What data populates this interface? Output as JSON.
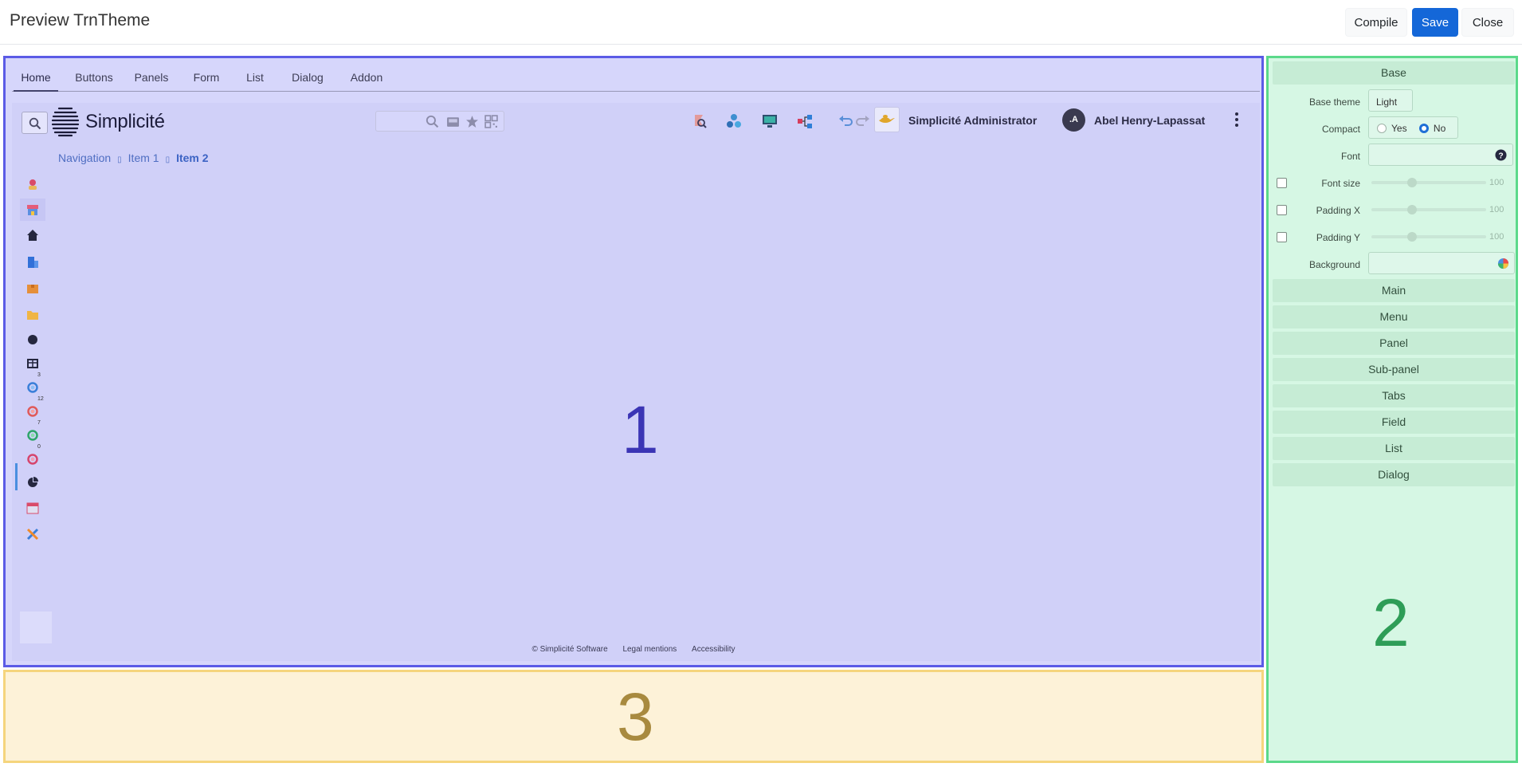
{
  "header": {
    "title": "Preview TrnTheme",
    "buttons": {
      "compile": "Compile",
      "save": "Save",
      "close": "Close"
    }
  },
  "zone1": {
    "label": "1",
    "tabs": [
      "Home",
      "Buttons",
      "Panels",
      "Form",
      "List",
      "Dialog",
      "Addon"
    ],
    "active_tab": "Home",
    "app": {
      "brand": "Simplicité",
      "admin_name": "Simplicité Administrator",
      "user_name": "Abel Henry-Lapassat",
      "avatar_initials": ".A",
      "breadcrumb": [
        "Navigation",
        "Item 1",
        "Item 2"
      ],
      "breadcrumb_separator": "▯",
      "sidebar": [
        {
          "icon": "user-icon"
        },
        {
          "icon": "store-icon",
          "selected": true
        },
        {
          "icon": "home-icon"
        },
        {
          "icon": "building-icon"
        },
        {
          "icon": "box-icon"
        },
        {
          "icon": "folder-icon"
        },
        {
          "icon": "circle-icon"
        },
        {
          "icon": "table-icon"
        },
        {
          "icon": "badge-blue-icon",
          "badge": "3"
        },
        {
          "icon": "badge-red-icon",
          "badge": "12"
        },
        {
          "icon": "badge-green-icon",
          "badge": "7"
        },
        {
          "icon": "badge-pink-icon",
          "badge": "0"
        },
        {
          "icon": "pie-chart-icon"
        },
        {
          "icon": "calendar-icon"
        },
        {
          "icon": "tools-icon"
        }
      ],
      "footer": [
        "© Simplicité Software",
        "Legal mentions",
        "Accessibility"
      ]
    }
  },
  "zone2": {
    "label": "2",
    "base_section": "Base",
    "fields": {
      "base_theme_label": "Base theme",
      "base_theme_value": "Light",
      "compact_label": "Compact",
      "compact_yes": "Yes",
      "compact_no": "No",
      "compact_selected": "No",
      "font_label": "Font",
      "font_value": "",
      "font_size_label": "Font size",
      "font_size_value": "100",
      "padding_x_label": "Padding X",
      "padding_x_value": "100",
      "padding_y_label": "Padding Y",
      "padding_y_value": "100",
      "background_label": "Background",
      "background_value": ""
    },
    "sections": [
      "Main",
      "Menu",
      "Panel",
      "Sub-panel",
      "Tabs",
      "Field",
      "List",
      "Dialog"
    ]
  },
  "zone3": {
    "label": "3"
  },
  "colors": {
    "zone1_border": "#5b5be6",
    "zone2_border": "#5bd98a",
    "zone3_border": "#f5d57d",
    "save_button": "#1467d8"
  }
}
